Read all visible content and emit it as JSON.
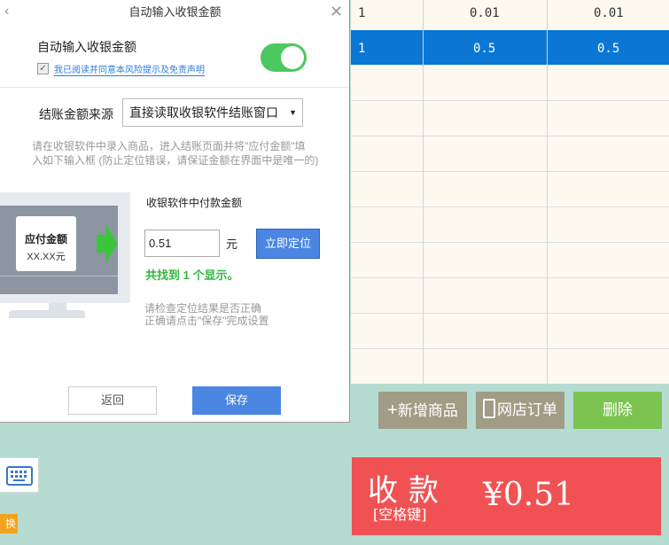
{
  "dialog": {
    "title": "自动输入收银金额",
    "auto_input_label": "自动输入收银金额",
    "agree_checked": true,
    "agree_text": "我已阅读并同意本风险提示及免责声明",
    "toggle_on": true,
    "source_label": "结账金额来源",
    "source_value": "直接读取收银软件结账窗口",
    "hint_line1": "请在收银软件中录入商品，进入结账页面并将\"应付金额\"填",
    "hint_line2": "入如下输入框 (防止定位错误，请保证金额在界面中是唯一的)",
    "illus_card_title": "应付金额",
    "illus_card_value": "XX.XX元",
    "amount_label": "收银软件中付款金额",
    "amount_value": "0.51",
    "unit": "元",
    "locate_button": "立即定位",
    "found_text": "共找到 1 个显示。",
    "check_hint_line1": "请检查定位结果是否正确",
    "check_hint_line2": "正确请点击\"保存\"完成设置",
    "back_button": "返回",
    "save_button": "保存"
  },
  "table": {
    "rows": [
      {
        "c1": "1",
        "c2": "0.01",
        "c3": "0.01",
        "selected": false
      },
      {
        "c1": "1",
        "c2": "0.5",
        "c3": "0.5",
        "selected": true
      }
    ]
  },
  "actions": {
    "add_product": "新增商品",
    "shop_orders": "网店订单",
    "delete": "删除"
  },
  "pay": {
    "title": "收款",
    "hint": "[空格键]",
    "amount": "¥0.51"
  },
  "side": {
    "tag": "换"
  },
  "colors": {
    "selected_row": "#0a77d4",
    "pay_red": "#f05254",
    "toggle_green": "#4cc860",
    "primary_blue": "#4a86e2",
    "action_gray": "#a09c85",
    "delete_green": "#7cc451",
    "found_green": "#33b640"
  }
}
